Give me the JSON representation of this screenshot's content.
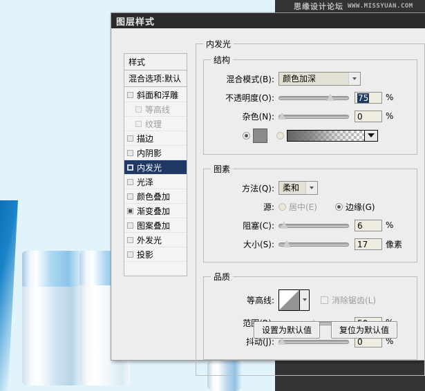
{
  "window": {
    "title": "图层样式"
  },
  "watermark": {
    "cn": "思缘设计论坛",
    "en": "WWW.MISSYUAN.COM"
  },
  "sidebar": {
    "header": "样式",
    "blending_option": "混合选项:默认",
    "items": [
      {
        "label": "斜面和浮雕",
        "checked": false,
        "indent": false,
        "active": false,
        "dim": false
      },
      {
        "label": "等高线",
        "checked": false,
        "indent": true,
        "active": false,
        "dim": true
      },
      {
        "label": "纹理",
        "checked": false,
        "indent": true,
        "active": false,
        "dim": true
      },
      {
        "label": "描边",
        "checked": false,
        "indent": false,
        "active": false,
        "dim": false
      },
      {
        "label": "内阴影",
        "checked": false,
        "indent": false,
        "active": false,
        "dim": false
      },
      {
        "label": "内发光",
        "checked": true,
        "indent": false,
        "active": true,
        "dim": false
      },
      {
        "label": "光泽",
        "checked": false,
        "indent": false,
        "active": false,
        "dim": false
      },
      {
        "label": "颜色叠加",
        "checked": false,
        "indent": false,
        "active": false,
        "dim": false
      },
      {
        "label": "渐变叠加",
        "checked": true,
        "indent": false,
        "active": false,
        "dim": false
      },
      {
        "label": "图案叠加",
        "checked": false,
        "indent": false,
        "active": false,
        "dim": false
      },
      {
        "label": "外发光",
        "checked": false,
        "indent": false,
        "active": false,
        "dim": false
      },
      {
        "label": "投影",
        "checked": false,
        "indent": false,
        "active": false,
        "dim": false
      }
    ]
  },
  "panel": {
    "title": "内发光",
    "structure": {
      "legend": "结构",
      "blend_mode_label": "混合模式(B):",
      "blend_mode_value": "颜色加深",
      "opacity_label": "不透明度(O):",
      "opacity_value": "75",
      "opacity_unit": "%",
      "noise_label": "杂色(N):",
      "noise_value": "0",
      "noise_unit": "%",
      "fill_color_selected": true,
      "fill_gradient_selected": false
    },
    "elements": {
      "legend": "图素",
      "technique_label": "方法(Q):",
      "technique_value": "柔和",
      "source_label": "源:",
      "source_center": "居中(E)",
      "source_edge": "边缘(G)",
      "source_selected": "边缘(G)",
      "choke_label": "阻塞(C):",
      "choke_value": "6",
      "choke_unit": "%",
      "size_label": "大小(S):",
      "size_value": "17",
      "size_unit": "像素"
    },
    "quality": {
      "legend": "品质",
      "contour_label": "等高线:",
      "antialias_label": "消除锯齿(L)",
      "antialias_checked": false,
      "range_label": "范围(R):",
      "range_value": "50",
      "range_unit": "%",
      "jitter_label": "抖动(J):",
      "jitter_value": "0",
      "jitter_unit": "%"
    }
  },
  "buttons": {
    "set_default": "设置为默认值",
    "reset_default": "复位为默认值"
  }
}
